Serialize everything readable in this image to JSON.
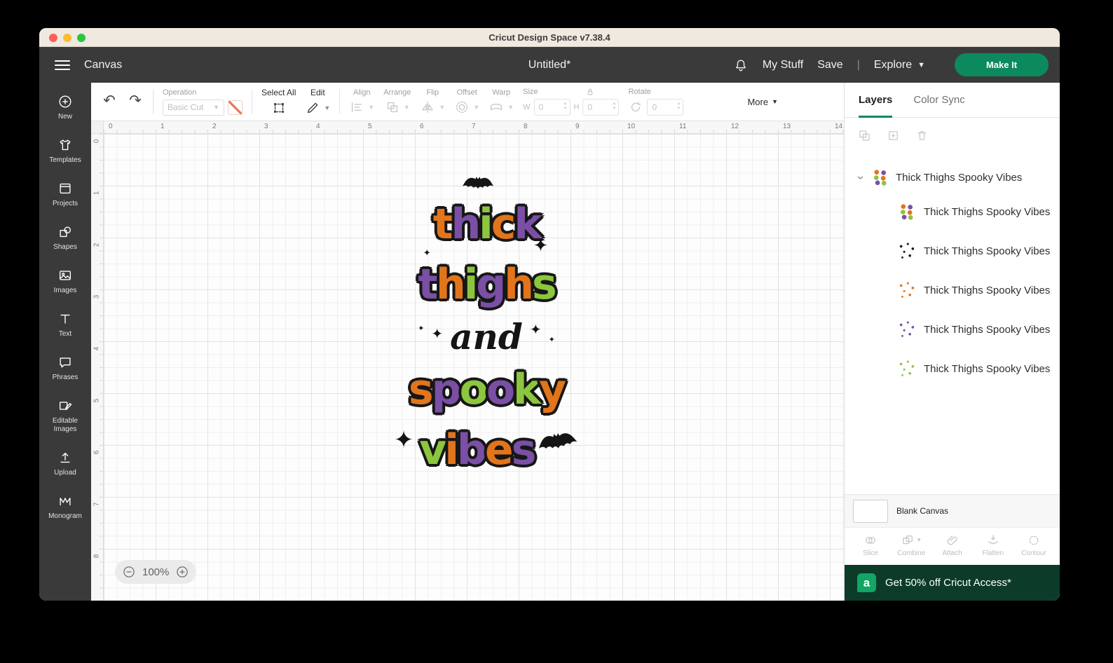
{
  "window": {
    "title": "Cricut Design Space  v7.38.4"
  },
  "header": {
    "canvas_label": "Canvas",
    "doc_title": "Untitled*",
    "my_stuff": "My Stuff",
    "save": "Save",
    "divider": "|",
    "explore": "Explore",
    "make_it": "Make It"
  },
  "sidebar": {
    "items": [
      {
        "id": "new",
        "label": "New"
      },
      {
        "id": "templates",
        "label": "Templates"
      },
      {
        "id": "projects",
        "label": "Projects"
      },
      {
        "id": "shapes",
        "label": "Shapes"
      },
      {
        "id": "images",
        "label": "Images"
      },
      {
        "id": "text",
        "label": "Text"
      },
      {
        "id": "phrases",
        "label": "Phrases"
      },
      {
        "id": "editable-images",
        "label": "Editable Images"
      },
      {
        "id": "upload",
        "label": "Upload"
      },
      {
        "id": "monogram",
        "label": "Monogram"
      }
    ]
  },
  "toolbar": {
    "operation_label": "Operation",
    "operation_value": "Basic Cut",
    "select_all": "Select All",
    "edit": "Edit",
    "align": "Align",
    "arrange": "Arrange",
    "flip": "Flip",
    "offset": "Offset",
    "warp": "Warp",
    "size_label": "Size",
    "w_label": "W",
    "w_value": "0",
    "h_label": "H",
    "h_value": "0",
    "rotate_label": "Rotate",
    "rotate_value": "0",
    "more": "More"
  },
  "ruler": {
    "top": [
      "0",
      "1",
      "2",
      "3",
      "4",
      "5",
      "6",
      "7",
      "8",
      "9",
      "10",
      "11",
      "12",
      "13",
      "14"
    ],
    "left": [
      "0",
      "1",
      "2",
      "3",
      "4",
      "5",
      "6",
      "7",
      "8"
    ]
  },
  "zoom": {
    "level": "100%"
  },
  "artwork": {
    "palette": {
      "orange": "#E2751B",
      "purple": "#7A4FA5",
      "green": "#8CC63E",
      "ink": "#171717"
    },
    "words": [
      {
        "text": "thick",
        "colors": [
          "orange",
          "purple",
          "green",
          "orange",
          "purple"
        ]
      },
      {
        "text": "thighs",
        "colors": [
          "purple",
          "orange",
          "green",
          "purple",
          "orange",
          "green"
        ]
      },
      {
        "text": "and",
        "style": "script"
      },
      {
        "text": "spooky",
        "colors": [
          "orange",
          "purple",
          "green",
          "purple",
          "green",
          "orange"
        ]
      },
      {
        "text": "vibes",
        "colors": [
          "green",
          "orange",
          "purple",
          "orange",
          "purple"
        ]
      }
    ],
    "sparkle": "✦"
  },
  "layers_panel": {
    "tabs": [
      {
        "label": "Layers",
        "active": true
      },
      {
        "label": "Color Sync",
        "active": false
      }
    ],
    "group": {
      "label": "Thick Thighs Spooky Vibes"
    },
    "layers": [
      {
        "label": "Thick Thighs Spooky Vibes",
        "thumb": "design"
      },
      {
        "label": "Thick Thighs Spooky Vibes",
        "thumb": "dots:#1a1a1a"
      },
      {
        "label": "Thick Thighs Spooky Vibes",
        "thumb": "dots:#E2751B"
      },
      {
        "label": "Thick Thighs Spooky Vibes",
        "thumb": "dots:#7A4FA5"
      },
      {
        "label": "Thick Thighs Spooky Vibes",
        "thumb": "dots:#8CC63E"
      }
    ],
    "blank_canvas": "Blank Canvas",
    "tools": [
      {
        "id": "slice",
        "label": "Slice"
      },
      {
        "id": "combine",
        "label": "Combine",
        "caret": true
      },
      {
        "id": "attach",
        "label": "Attach"
      },
      {
        "id": "flatten",
        "label": "Flatten"
      },
      {
        "id": "contour",
        "label": "Contour"
      }
    ],
    "banner": {
      "text": "Get 50% off Cricut Access*",
      "icon_letter": "a"
    }
  },
  "colors": {
    "accent_green": "#0C8A5E",
    "banner_bg": "#0C3B2A",
    "banner_icon": "#12A564"
  }
}
